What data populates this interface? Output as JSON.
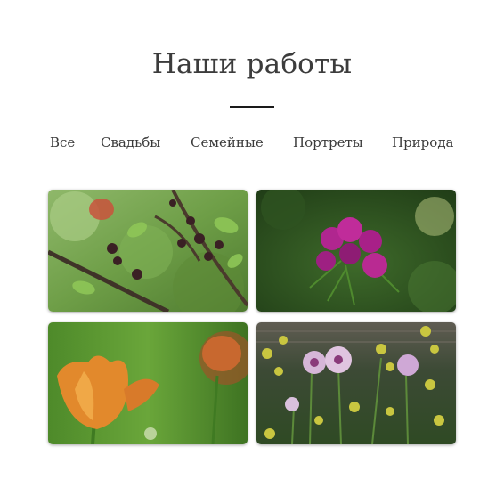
{
  "header": {
    "title": "Наши работы"
  },
  "filters": [
    {
      "label": "Все"
    },
    {
      "label": "Свадьбы"
    },
    {
      "label": "Семейные"
    },
    {
      "label": "Портреты"
    },
    {
      "label": "Природа"
    }
  ],
  "gallery": {
    "items": [
      {
        "subject": "berry branch photo"
      },
      {
        "subject": "pink carnation photo"
      },
      {
        "subject": "orange tulip photo"
      },
      {
        "subject": "poppies photo"
      }
    ]
  },
  "colors": {
    "text": "#3a3a3a",
    "divider": "#1a1a1a",
    "background": "#ffffff"
  }
}
